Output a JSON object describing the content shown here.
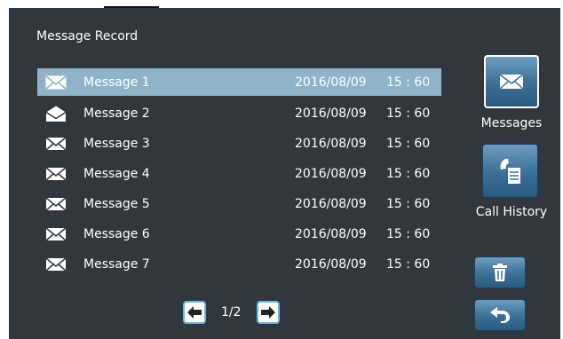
{
  "page_title": "Message Record",
  "messages": [
    {
      "name": "Message 1",
      "date": "2016/08/09",
      "time": "15 : 60",
      "selected": true,
      "read": false
    },
    {
      "name": "Message 2",
      "date": "2016/08/09",
      "time": "15 : 60",
      "selected": false,
      "read": true
    },
    {
      "name": "Message 3",
      "date": "2016/08/09",
      "time": "15 : 60",
      "selected": false,
      "read": false
    },
    {
      "name": "Message 4",
      "date": "2016/08/09",
      "time": "15 : 60",
      "selected": false,
      "read": false
    },
    {
      "name": "Message 5",
      "date": "2016/08/09",
      "time": "15 : 60",
      "selected": false,
      "read": false
    },
    {
      "name": "Message 6",
      "date": "2016/08/09",
      "time": "15 : 60",
      "selected": false,
      "read": false
    },
    {
      "name": "Message 7",
      "date": "2016/08/09",
      "time": "15 : 60",
      "selected": false,
      "read": false
    }
  ],
  "pagination": {
    "label": "1/2",
    "prev_icon": "arrow-left-icon",
    "next_icon": "arrow-right-icon"
  },
  "sidebar": {
    "messages": {
      "label": "Messages",
      "icon": "envelope-icon",
      "active": true
    },
    "call_history": {
      "label": "Call History",
      "icon": "phone-receiver-icon",
      "active": false
    },
    "delete": {
      "icon": "trash-icon"
    },
    "back": {
      "icon": "return-arrow-icon"
    }
  },
  "colors": {
    "background": "#31373f",
    "selected_row": "#8fb3c8",
    "button_blue": "#3b6f95",
    "pager_border": "#6ab7e0"
  }
}
